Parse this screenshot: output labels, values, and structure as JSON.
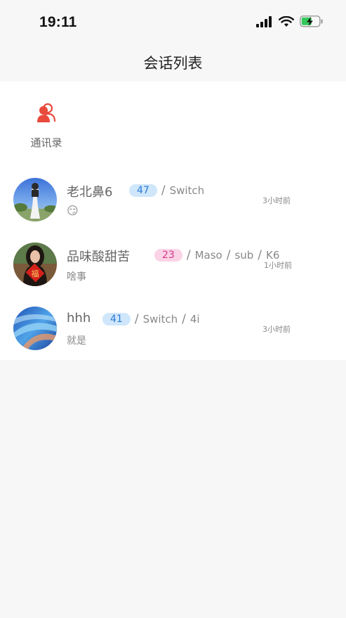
{
  "status_bar": {
    "time": "19:11",
    "icons": [
      "signal-icon",
      "wifi-icon",
      "battery-charging-icon"
    ]
  },
  "header": {
    "title": "会话列表"
  },
  "contacts": {
    "label": "通讯录",
    "icon": "contacts-icon",
    "icon_color": "#e84a3c"
  },
  "conversations": [
    {
      "name": "老北鼻6",
      "badge": "47",
      "badge_color": "blue",
      "tags": [
        "Switch"
      ],
      "time": "3小时前",
      "preview": "😏"
    },
    {
      "name": "品味酸甜苦",
      "badge": "23",
      "badge_color": "pink",
      "tags": [
        "Maso",
        "sub",
        "K6"
      ],
      "time": "1小时前",
      "preview": "啥事"
    },
    {
      "name": "hhh",
      "badge": "41",
      "badge_color": "blue",
      "tags": [
        "Switch",
        "4i"
      ],
      "time": "3小时前",
      "preview": "就是"
    }
  ]
}
